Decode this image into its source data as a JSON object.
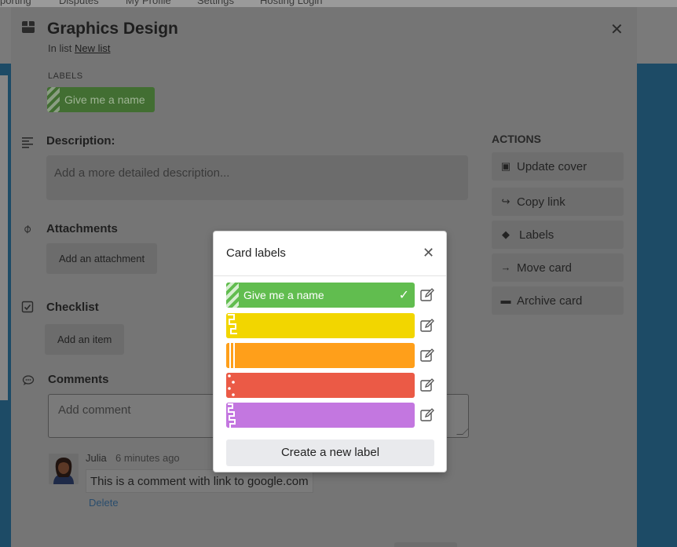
{
  "background": {
    "nav_items": [
      "porting",
      "Disputes",
      "My Profile",
      "Settings",
      "Hosting Login"
    ]
  },
  "card": {
    "title": "Graphics Design",
    "in_list_prefix": "In list",
    "list_name": "New list",
    "labels_heading": "LABELS",
    "applied_label": "Give me a name",
    "description": {
      "title": "Description:",
      "placeholder": "Add a more detailed description..."
    },
    "attachments": {
      "title": "Attachments",
      "button": "Add an attachment"
    },
    "checklist": {
      "title": "Checklist",
      "button": "Add an item"
    },
    "comments": {
      "title": "Comments",
      "placeholder": "Add comment",
      "items": [
        {
          "author": "Julia",
          "time": "6 minutes ago",
          "text": "This is a comment with link to google.com",
          "delete_label": "Delete"
        }
      ]
    }
  },
  "actions": {
    "heading": "ACTIONS",
    "items": [
      {
        "label": "Update cover",
        "icon": "image-icon"
      },
      {
        "label": "Copy link",
        "icon": "share-arrow-icon"
      },
      {
        "label": "Labels",
        "icon": "tags-icon"
      },
      {
        "label": "Move card",
        "icon": "arrow-right-icon"
      },
      {
        "label": "Archive card",
        "icon": "trash-icon"
      }
    ]
  },
  "label_popover": {
    "title": "Card labels",
    "labels": [
      {
        "name": "Give me a name",
        "color": "#61bd4f",
        "selected": true,
        "pattern": "stripes"
      },
      {
        "name": "",
        "color": "#f2d600",
        "selected": false,
        "pattern": "steps"
      },
      {
        "name": "",
        "color": "#ff9f1a",
        "selected": false,
        "pattern": "bars"
      },
      {
        "name": "",
        "color": "#eb5a46",
        "selected": false,
        "pattern": "dots"
      },
      {
        "name": "",
        "color": "#c377e0",
        "selected": false,
        "pattern": "zigzag"
      }
    ],
    "create_label": "Create a new label"
  }
}
